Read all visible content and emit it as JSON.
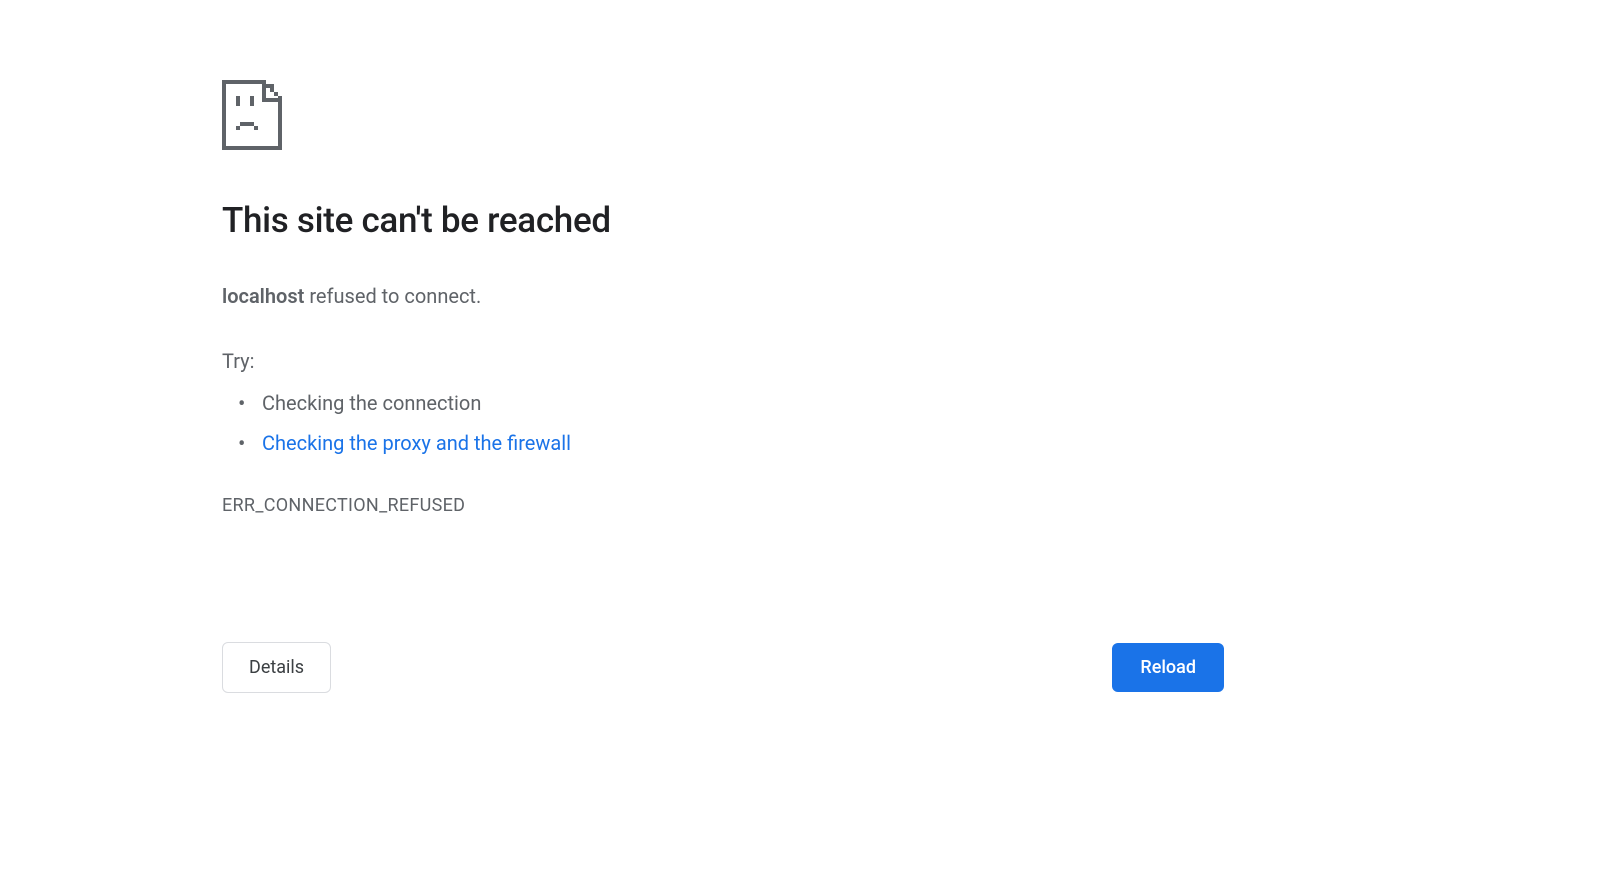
{
  "error": {
    "title": "This site can't be reached",
    "hostname": "localhost",
    "message_suffix": " refused to connect.",
    "try_label": "Try:",
    "suggestions": [
      {
        "text": "Checking the connection",
        "is_link": false
      },
      {
        "text": "Checking the proxy and the firewall",
        "is_link": true
      }
    ],
    "error_code": "ERR_CONNECTION_REFUSED"
  },
  "buttons": {
    "details": "Details",
    "reload": "Reload"
  },
  "colors": {
    "text_primary": "#202124",
    "text_secondary": "#5f6368",
    "link": "#1a73e8",
    "button_primary_bg": "#1a73e8",
    "button_primary_text": "#ffffff",
    "button_secondary_border": "#dadce0"
  }
}
